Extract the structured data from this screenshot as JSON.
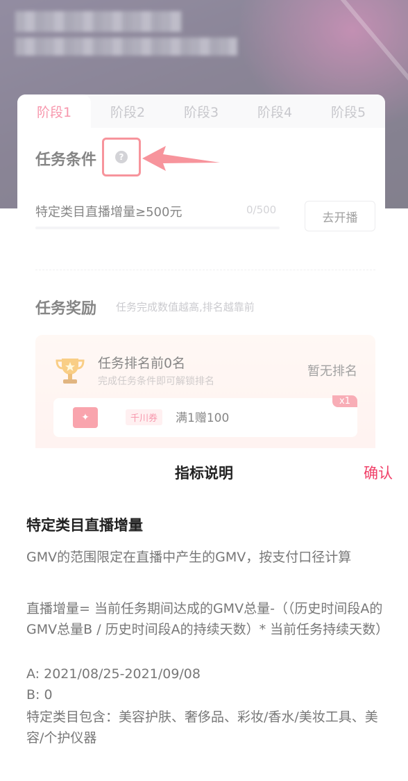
{
  "stage_tabs": [
    "阶段1",
    "阶段2",
    "阶段3",
    "阶段4",
    "阶段5"
  ],
  "active_tab_index": 0,
  "task_condition": {
    "title": "任务条件",
    "help_icon": "question-circle-icon",
    "items": [
      {
        "label": "特定类目直播增量≥500元",
        "progress_text": "0/500",
        "progress": 0,
        "action": "去开播"
      }
    ]
  },
  "task_reward": {
    "title": "任务奖励",
    "subtitle": "任务完成数值越高,排名越靠前",
    "rank": {
      "title": "任务排名前0名",
      "subtitle": "完成任务条件即可解锁排名",
      "status": "暂无排名",
      "icon": "trophy-icon"
    },
    "coupon": {
      "icon": "coupon-icon",
      "tag": "千川券",
      "text": "满1赠100",
      "multiplier": "x1"
    }
  },
  "sheet": {
    "title": "指标说明",
    "confirm": "确认",
    "heading": "特定类目直播增量",
    "paragraphs": [
      "GMV的范围限定在直播中产生的GMV，按支付口径计算",
      "直播增量= 当前任务期间达成的GMV总量-（（历史时间段A的GMV总量B / 历史时间段A的持续天数）* 当前任务持续天数）",
      "A: 2021/08/25-2021/09/08",
      "B: 0",
      "特定类目包含：美容护肤、奢侈品、彩妆/香水/美妆工具、美容/个护仪器"
    ]
  },
  "colors": {
    "accent": "#f04068",
    "highlight_box": "#f03c4b"
  }
}
